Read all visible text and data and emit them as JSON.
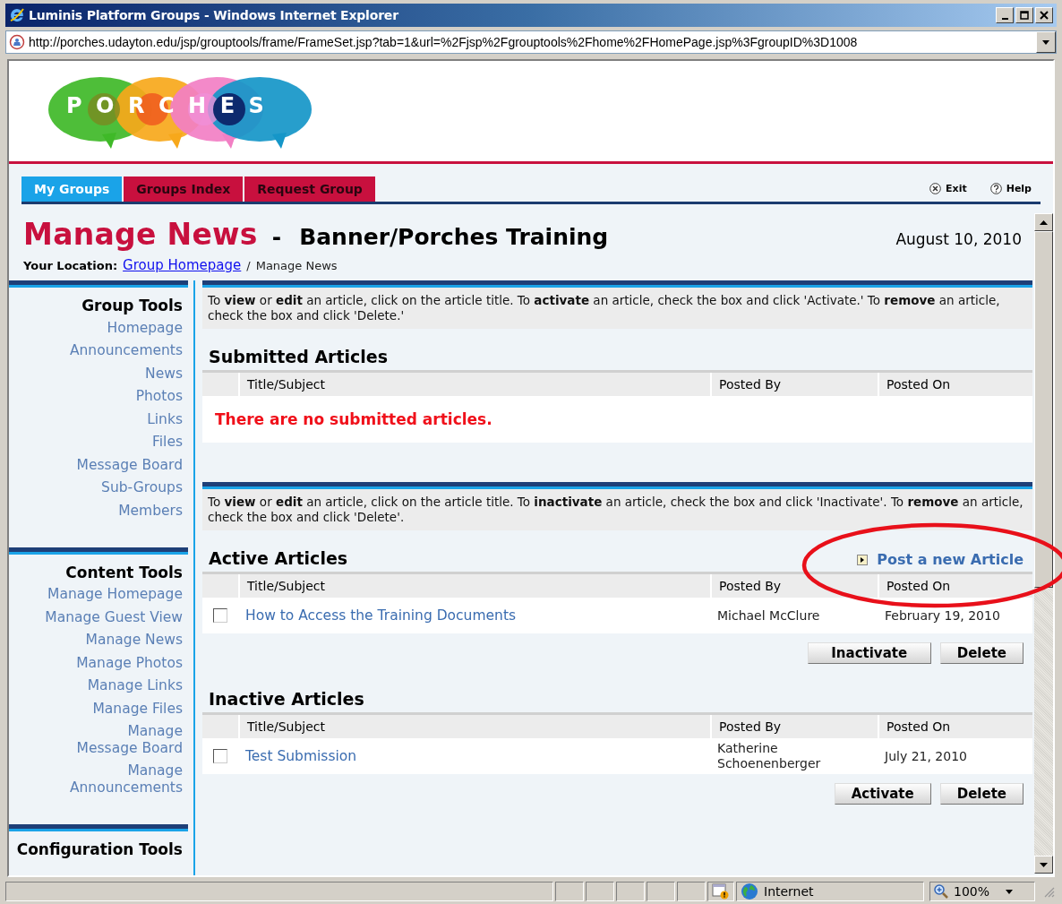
{
  "window": {
    "title": "Luminis Platform Groups - Windows Internet Explorer"
  },
  "address_bar": {
    "url": "http://porches.udayton.edu/jsp/grouptools/frame/FrameSet.jsp?tab=1&url=%2Fjsp%2Fgrouptools%2Fhome%2FHomePage.jsp%3FgroupID%3D1008"
  },
  "logo": {
    "text": "PORCHES"
  },
  "tabs": [
    {
      "label": "My Groups",
      "selected": true
    },
    {
      "label": "Groups Index",
      "selected": false
    },
    {
      "label": "Request Group",
      "selected": false
    }
  ],
  "header_links": [
    {
      "kind": "exit",
      "label": "Exit"
    },
    {
      "kind": "help",
      "label": "Help"
    }
  ],
  "page": {
    "title": "Manage News",
    "separator": "-",
    "subtitle": "Banner/Porches Training",
    "date": "August 10, 2010"
  },
  "breadcrumb": {
    "label": "Your Location:",
    "link": "Group Homepage",
    "separator": "/",
    "current": "Manage News"
  },
  "sidebar": [
    {
      "title": "Group Tools",
      "items": [
        "Homepage",
        "Announcements",
        "News",
        "Photos",
        "Links",
        "Files",
        "Message Board",
        "Sub-Groups",
        "Members"
      ]
    },
    {
      "title": "Content Tools",
      "items": [
        "Manage Homepage",
        "Manage Guest View",
        "Manage News",
        "Manage Photos",
        "Manage Links",
        "Manage Files",
        "Manage\nMessage Board",
        "Manage\nAnnouncements"
      ]
    },
    {
      "title": "Configuration Tools"
    }
  ],
  "submitted": {
    "instructions": "To **view** or **edit** an article, click on the article title. To **activate** an article, check the box and click 'Activate.' To **remove** an article, check the box and click 'Delete.'",
    "heading": "Submitted Articles",
    "columns": [
      "Title/Subject",
      "Posted By",
      "Posted On"
    ],
    "empty_message": "There are no submitted articles."
  },
  "active": {
    "instructions": "To **view** or **edit** an article, click on the article title. To **inactivate** an article, check the box and click 'Inactivate'. To **remove** an article, check the box and click 'Delete'.",
    "heading": "Active Articles",
    "post_link": "Post a new Article",
    "columns": [
      "Title/Subject",
      "Posted By",
      "Posted On"
    ],
    "rows": [
      {
        "checked": false,
        "title": "How to Access the Training Documents",
        "posted_by": "Michael McClure",
        "posted_on": "February 19, 2010"
      }
    ],
    "buttons": [
      "Inactivate",
      "Delete"
    ]
  },
  "inactive": {
    "heading": "Inactive Articles",
    "columns": [
      "Title/Subject",
      "Posted By",
      "Posted On"
    ],
    "rows": [
      {
        "checked": false,
        "title": "Test Submission",
        "posted_by": "Katherine Schoenenberger",
        "posted_on": "July 21, 2010"
      }
    ],
    "buttons": [
      "Activate",
      "Delete"
    ]
  },
  "status_bar": {
    "zone": "Internet",
    "zoom": "100%"
  }
}
